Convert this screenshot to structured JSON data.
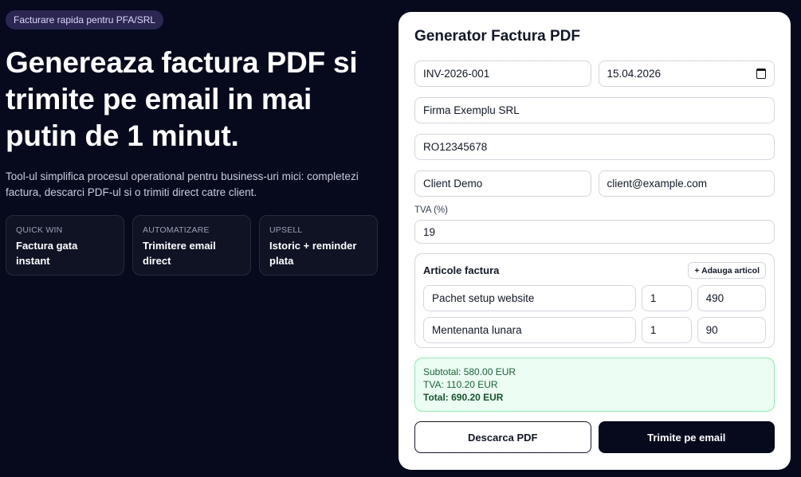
{
  "hero": {
    "badge": "Facturare rapida pentru PFA/SRL",
    "headline": "Genereaza factura PDF si trimite pe email in mai putin de 1 minut.",
    "lead": "Tool-ul simplifica procesul operational pentru business-uri mici: completezi factura, descarci PDF-ul si o trimiti direct catre client.",
    "cards": [
      {
        "kicker": "QUICK WIN",
        "title": "Factura gata instant"
      },
      {
        "kicker": "AUTOMATIZARE",
        "title": "Trimitere email direct"
      },
      {
        "kicker": "UPSELL",
        "title": "Istoric + reminder plata"
      }
    ]
  },
  "form": {
    "title": "Generator Factura PDF",
    "invoice_number": "INV-2026-001",
    "date": "15.04.2026",
    "company": "Firma Exemplu SRL",
    "cui": "RO12345678",
    "client_name": "Client Demo",
    "client_email": "client@example.com",
    "vat_label": "TVA (%)",
    "vat_value": "19",
    "items_title": "Articole factura",
    "add_item_label": "+ Adauga articol",
    "items": [
      {
        "desc": "Pachet setup website",
        "qty": "1",
        "price": "490"
      },
      {
        "desc": "Mentenanta lunara",
        "qty": "1",
        "price": "90"
      }
    ],
    "subtotal": "Subtotal: 580.00 EUR",
    "vat_total": "TVA: 110.20 EUR",
    "total": "Total: 690.20 EUR",
    "download_label": "Descarca PDF",
    "send_label": "Trimite pe email"
  },
  "colors": {
    "background": "#070a1d",
    "panel": "#ffffff",
    "totals_bg": "#ecfdf3",
    "totals_text": "#166534"
  }
}
